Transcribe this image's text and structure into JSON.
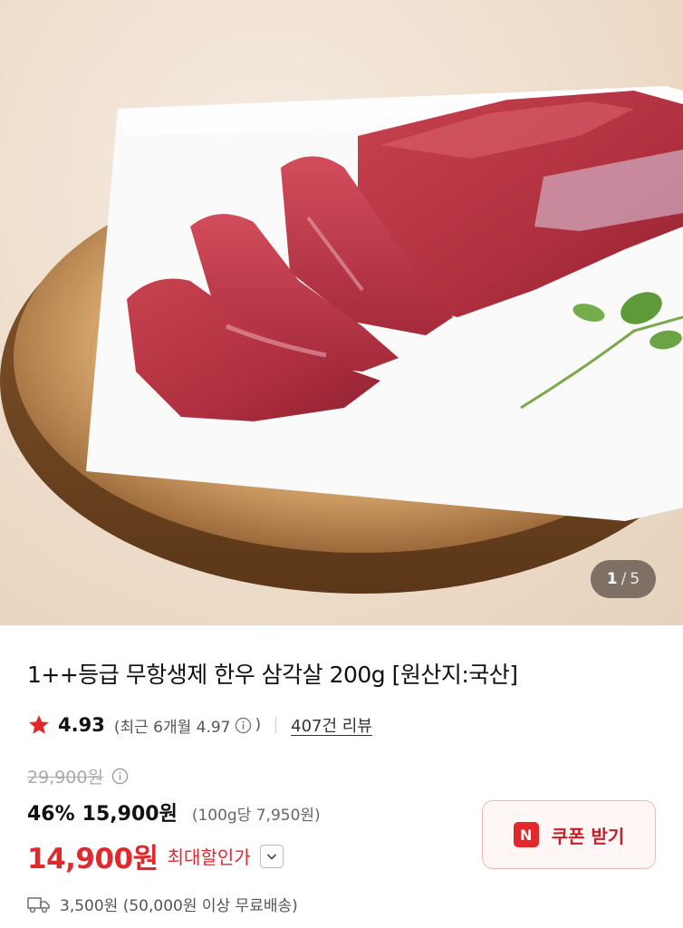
{
  "gallery": {
    "current": "1",
    "separator": "/",
    "total": "5"
  },
  "product": {
    "title": "1++등급 무항생제 한우 삼각살 200g [원산지:국산]",
    "rating": "4.93",
    "recent_rating_text": "(최근 6개월 4.97",
    "recent_rating_close": ")",
    "reviews_link": "407건 리뷰",
    "original_price": "29,900원",
    "discount_percent": "46%",
    "sale_price": "15,900원",
    "unit_price": "(100g당 7,950원)",
    "max_discount_price": "14,900원",
    "max_discount_label": "최대할인가",
    "shipping": "3,500원 (50,000원 이상 무료배송)"
  },
  "coupon": {
    "badge": "N",
    "label": "쿠폰 받기"
  },
  "colors": {
    "accent": "#e0282d",
    "star": "#e0282d",
    "coupon_bg": "#fff6f6"
  },
  "icons": [
    "star-icon",
    "info-icon",
    "chevron-down-icon",
    "truck-icon",
    "n-badge-icon"
  ]
}
